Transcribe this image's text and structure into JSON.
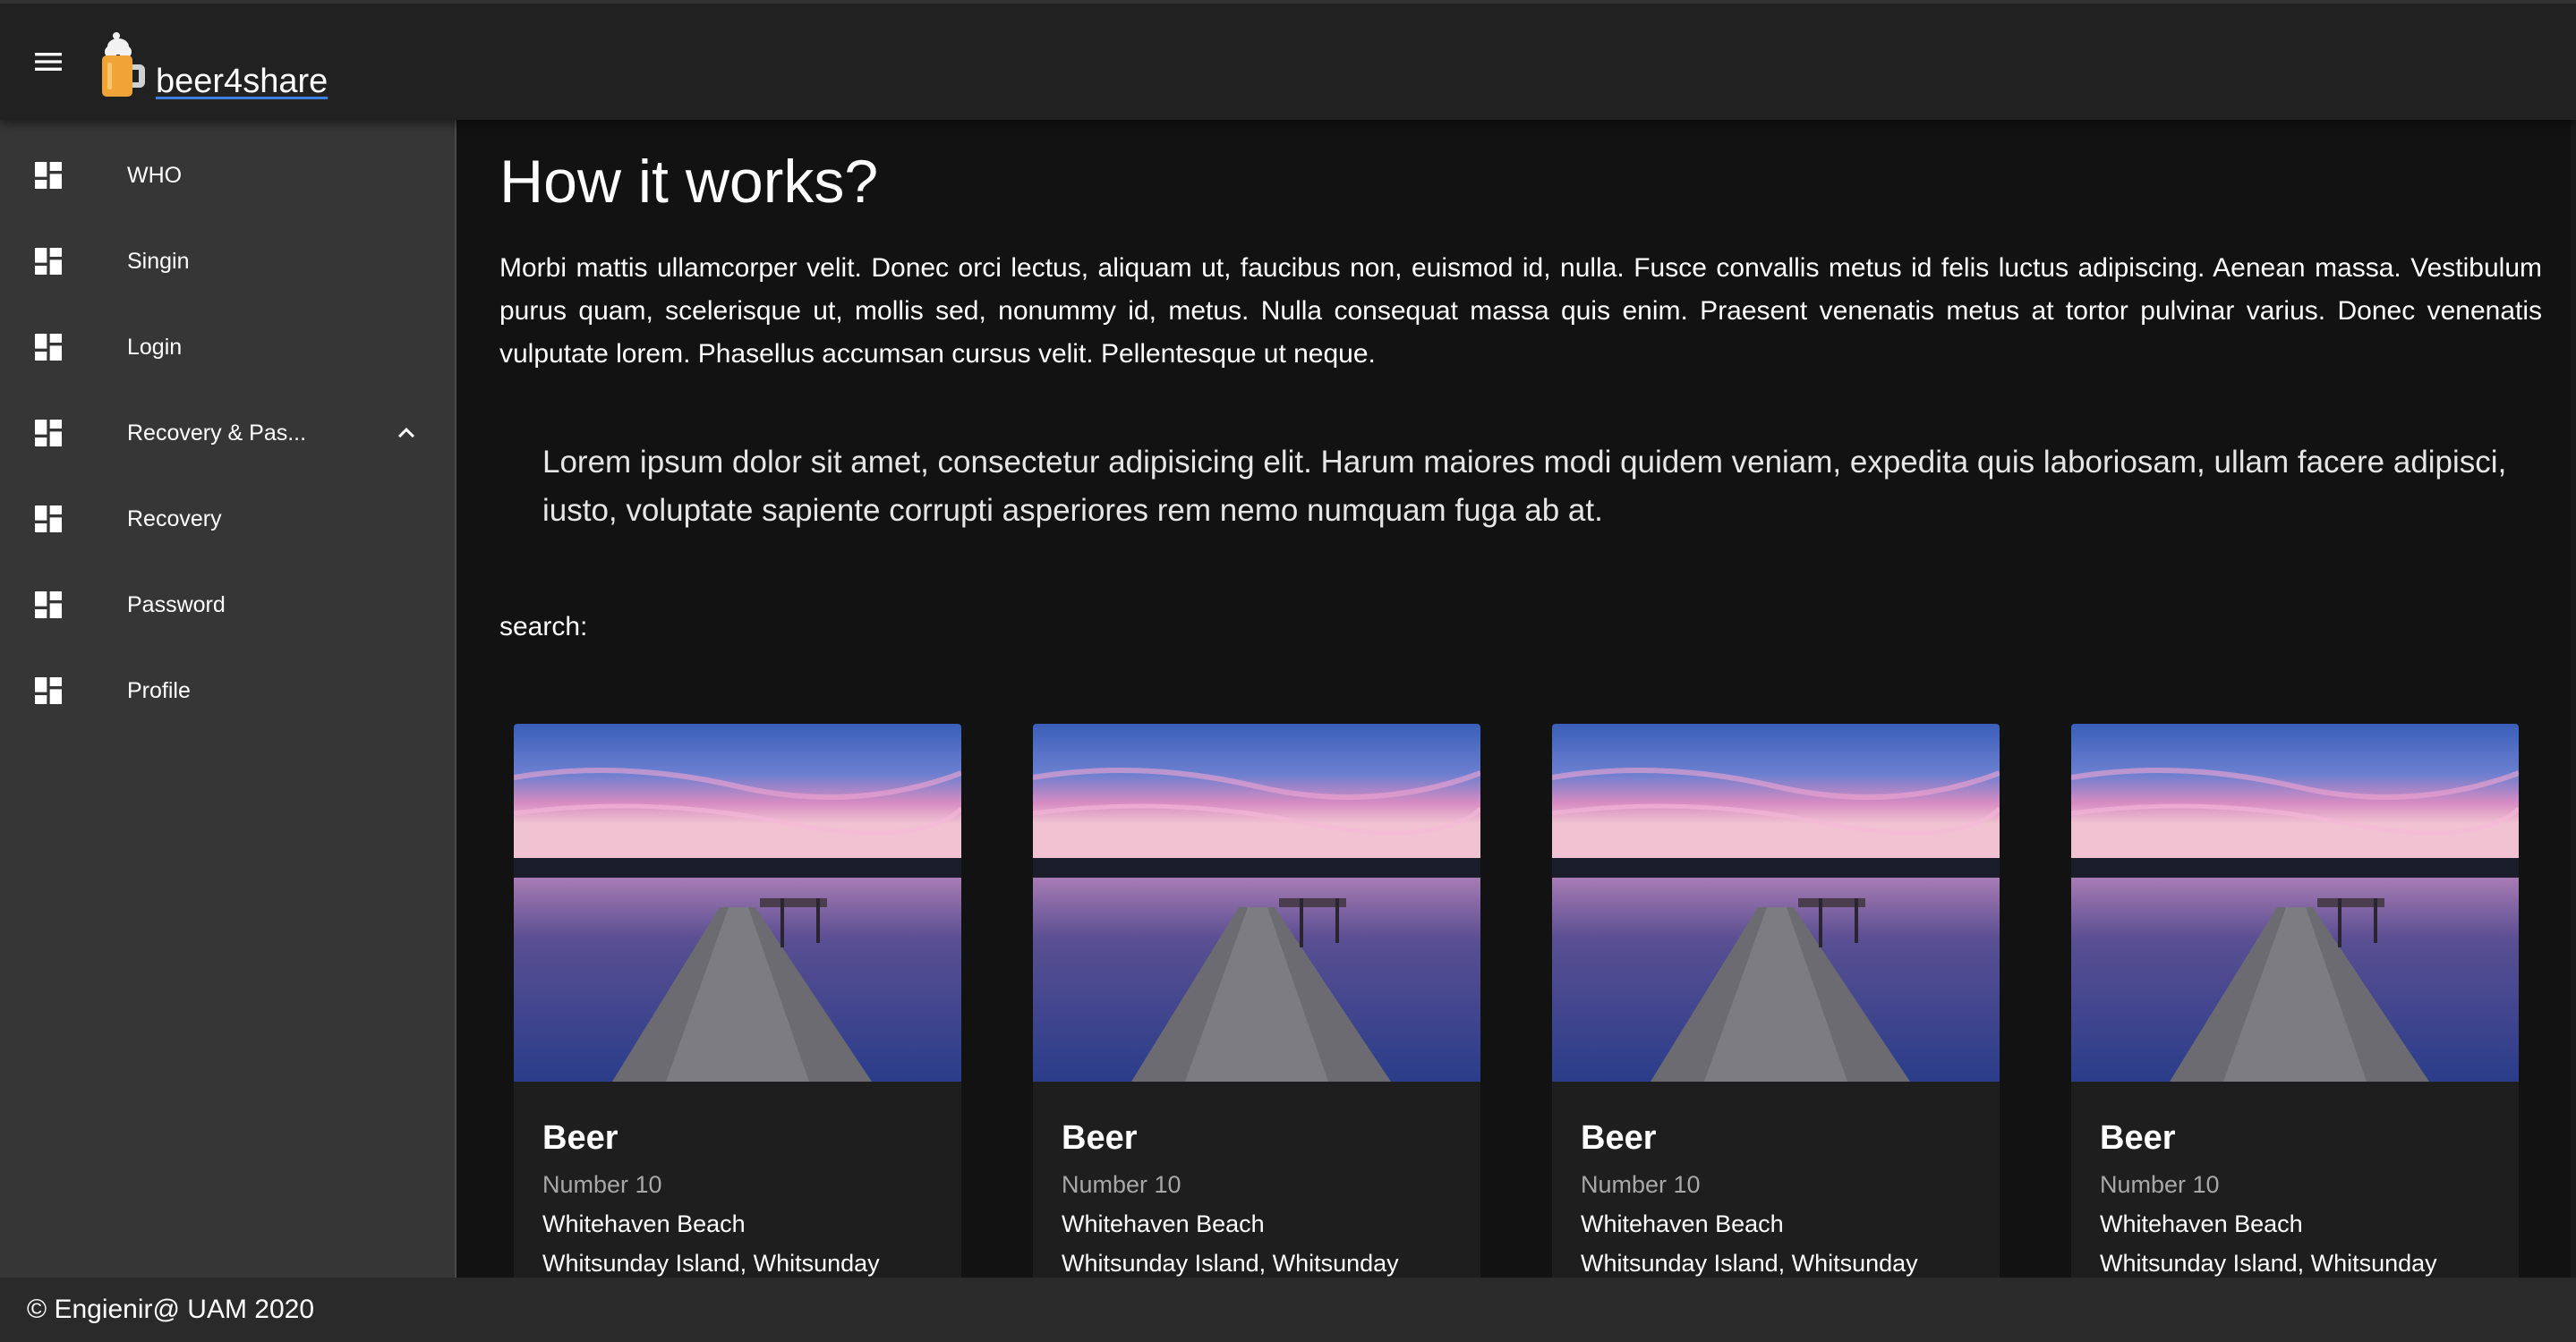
{
  "appbar": {
    "menu_icon": "hamburger-menu-icon",
    "logo_icon": "beer-mug-icon",
    "brand": "beer4share"
  },
  "sidebar": {
    "items": [
      {
        "label": "WHO",
        "icon": "dashboard-icon"
      },
      {
        "label": "Singin",
        "icon": "dashboard-icon"
      },
      {
        "label": "Login",
        "icon": "dashboard-icon"
      },
      {
        "label": "Recovery & Pas...",
        "icon": "dashboard-icon",
        "expanded": true,
        "chevron": "chevron-up-icon"
      },
      {
        "label": "Recovery",
        "icon": "dashboard-icon"
      },
      {
        "label": "Password",
        "icon": "dashboard-icon"
      },
      {
        "label": "Profile",
        "icon": "dashboard-icon"
      }
    ]
  },
  "main": {
    "heading": "How it works?",
    "paragraph": "Morbi mattis ullamcorper velit. Donec orci lectus, aliquam ut, faucibus non, euismod id, nulla. Fusce convallis metus id felis luctus adipiscing. Aenean massa. Vestibulum purus quam, scelerisque ut, mollis sed, nonummy id, metus. Nulla consequat massa quis enim. Praesent venenatis metus at tortor pulvinar varius. Donec venenatis vulputate lorem. Phasellus accumsan cursus velit. Pellentesque ut neque.",
    "quote": "Lorem ipsum dolor sit amet, consectetur adipisicing elit. Harum maiores modi quidem veniam, expedita quis laboriosam, ullam facere adipisci, iusto, voluptate sapiente corrupti asperiores rem nemo numquam fuga ab at.",
    "search_label": "search:"
  },
  "cards": [
    {
      "title": "Beer",
      "subtitle": "Number 10",
      "line1": "Whitehaven Beach",
      "line2": "Whitsunday Island, Whitsunday"
    },
    {
      "title": "Beer",
      "subtitle": "Number 10",
      "line1": "Whitehaven Beach",
      "line2": "Whitsunday Island, Whitsunday"
    },
    {
      "title": "Beer",
      "subtitle": "Number 10",
      "line1": "Whitehaven Beach",
      "line2": "Whitsunday Island, Whitsunday"
    },
    {
      "title": "Beer",
      "subtitle": "Number 10",
      "line1": "Whitehaven Beach",
      "line2": "Whitsunday Island, Whitsunday"
    }
  ],
  "footer": {
    "text": "© Engienir@ UAM 2020"
  },
  "colors": {
    "appbar": "#212121",
    "sidebar": "#363636",
    "main_bg": "#121212",
    "card_bg": "#1e1e1e",
    "link_underline": "#3f7fe0"
  }
}
